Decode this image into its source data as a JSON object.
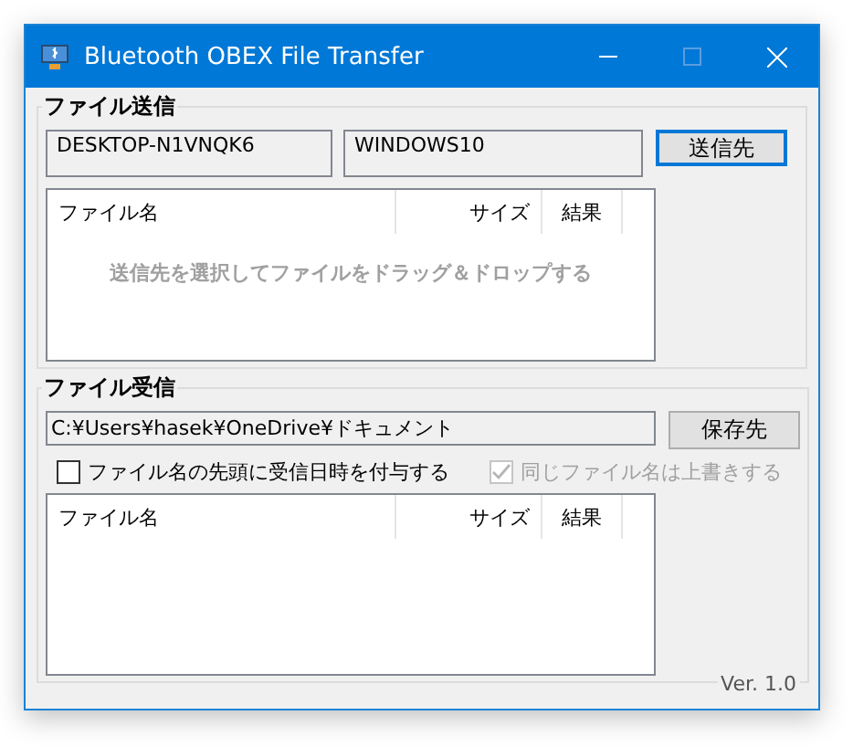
{
  "window": {
    "title": "Bluetooth OBEX File Transfer"
  },
  "send": {
    "title": "ファイル送信",
    "device_name": "DESKTOP-N1VNQK6",
    "device_os": "WINDOWS10",
    "button": "送信先",
    "columns": [
      "ファイル名",
      "サイズ",
      "結果"
    ],
    "hint": "送信先を選択してファイルをドラッグ＆ドロップする"
  },
  "receive": {
    "title": "ファイル受信",
    "path": "C:¥Users¥hasek¥OneDrive¥ドキュメント",
    "button": "保存先",
    "options": [
      {
        "label": "ファイル名の先頭に受信日時を付与する",
        "checked": false,
        "disabled": false
      },
      {
        "label": "同じファイル名は上書きする",
        "checked": true,
        "disabled": true
      }
    ],
    "columns": [
      "ファイル名",
      "サイズ",
      "結果"
    ]
  },
  "version": "Ver. 1.0"
}
